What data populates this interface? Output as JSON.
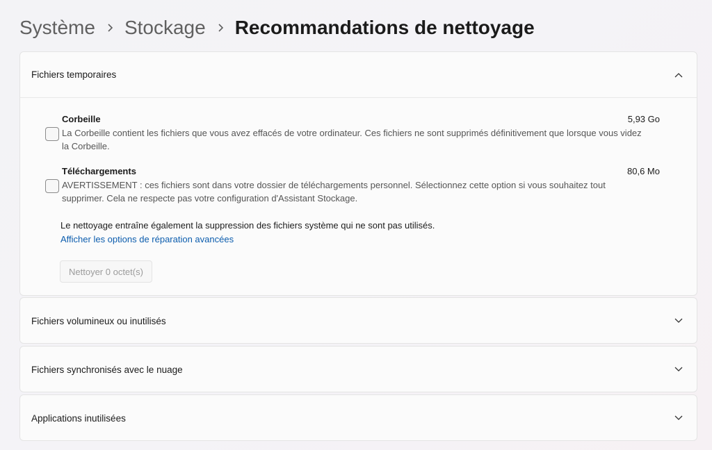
{
  "breadcrumb": {
    "items": [
      "Système",
      "Stockage"
    ],
    "current": "Recommandations de nettoyage"
  },
  "sections": {
    "temp": {
      "label": "Fichiers temporaires",
      "expanded": true,
      "items": [
        {
          "title": "Corbeille",
          "size": "5,93 Go",
          "description": "La Corbeille contient les fichiers que vous avez effacés de votre ordinateur. Ces fichiers ne sont supprimés définitivement que lorsque vous videz la Corbeille.",
          "checked": false
        },
        {
          "title": "Téléchargements",
          "size": "80,6 Mo",
          "description": "AVERTISSEMENT : ces fichiers sont dans votre dossier de téléchargements personnel. Sélectionnez cette option si vous souhaitez tout supprimer. Cela ne respecte pas votre configuration d'Assistant Stockage.",
          "checked": false
        }
      ],
      "note": "Le nettoyage entraîne également la suppression des fichiers système qui ne sont pas utilisés.",
      "advanced_link": "Afficher les options de réparation avancées",
      "clean_button": "Nettoyer 0 octet(s)"
    },
    "large": {
      "label": "Fichiers volumineux ou inutilisés",
      "expanded": false
    },
    "cloud": {
      "label": "Fichiers synchronisés avec le nuage",
      "expanded": false
    },
    "apps": {
      "label": "Applications inutilisées",
      "expanded": false
    }
  },
  "icons": {
    "breadcrumb_separator": "chevron-right-icon",
    "expanded": "chevron-up-icon",
    "collapsed": "chevron-down-icon"
  },
  "colors": {
    "link": "#0b5cad",
    "card_background": "#fbfbfb",
    "disabled_text": "#9b9b9b"
  }
}
